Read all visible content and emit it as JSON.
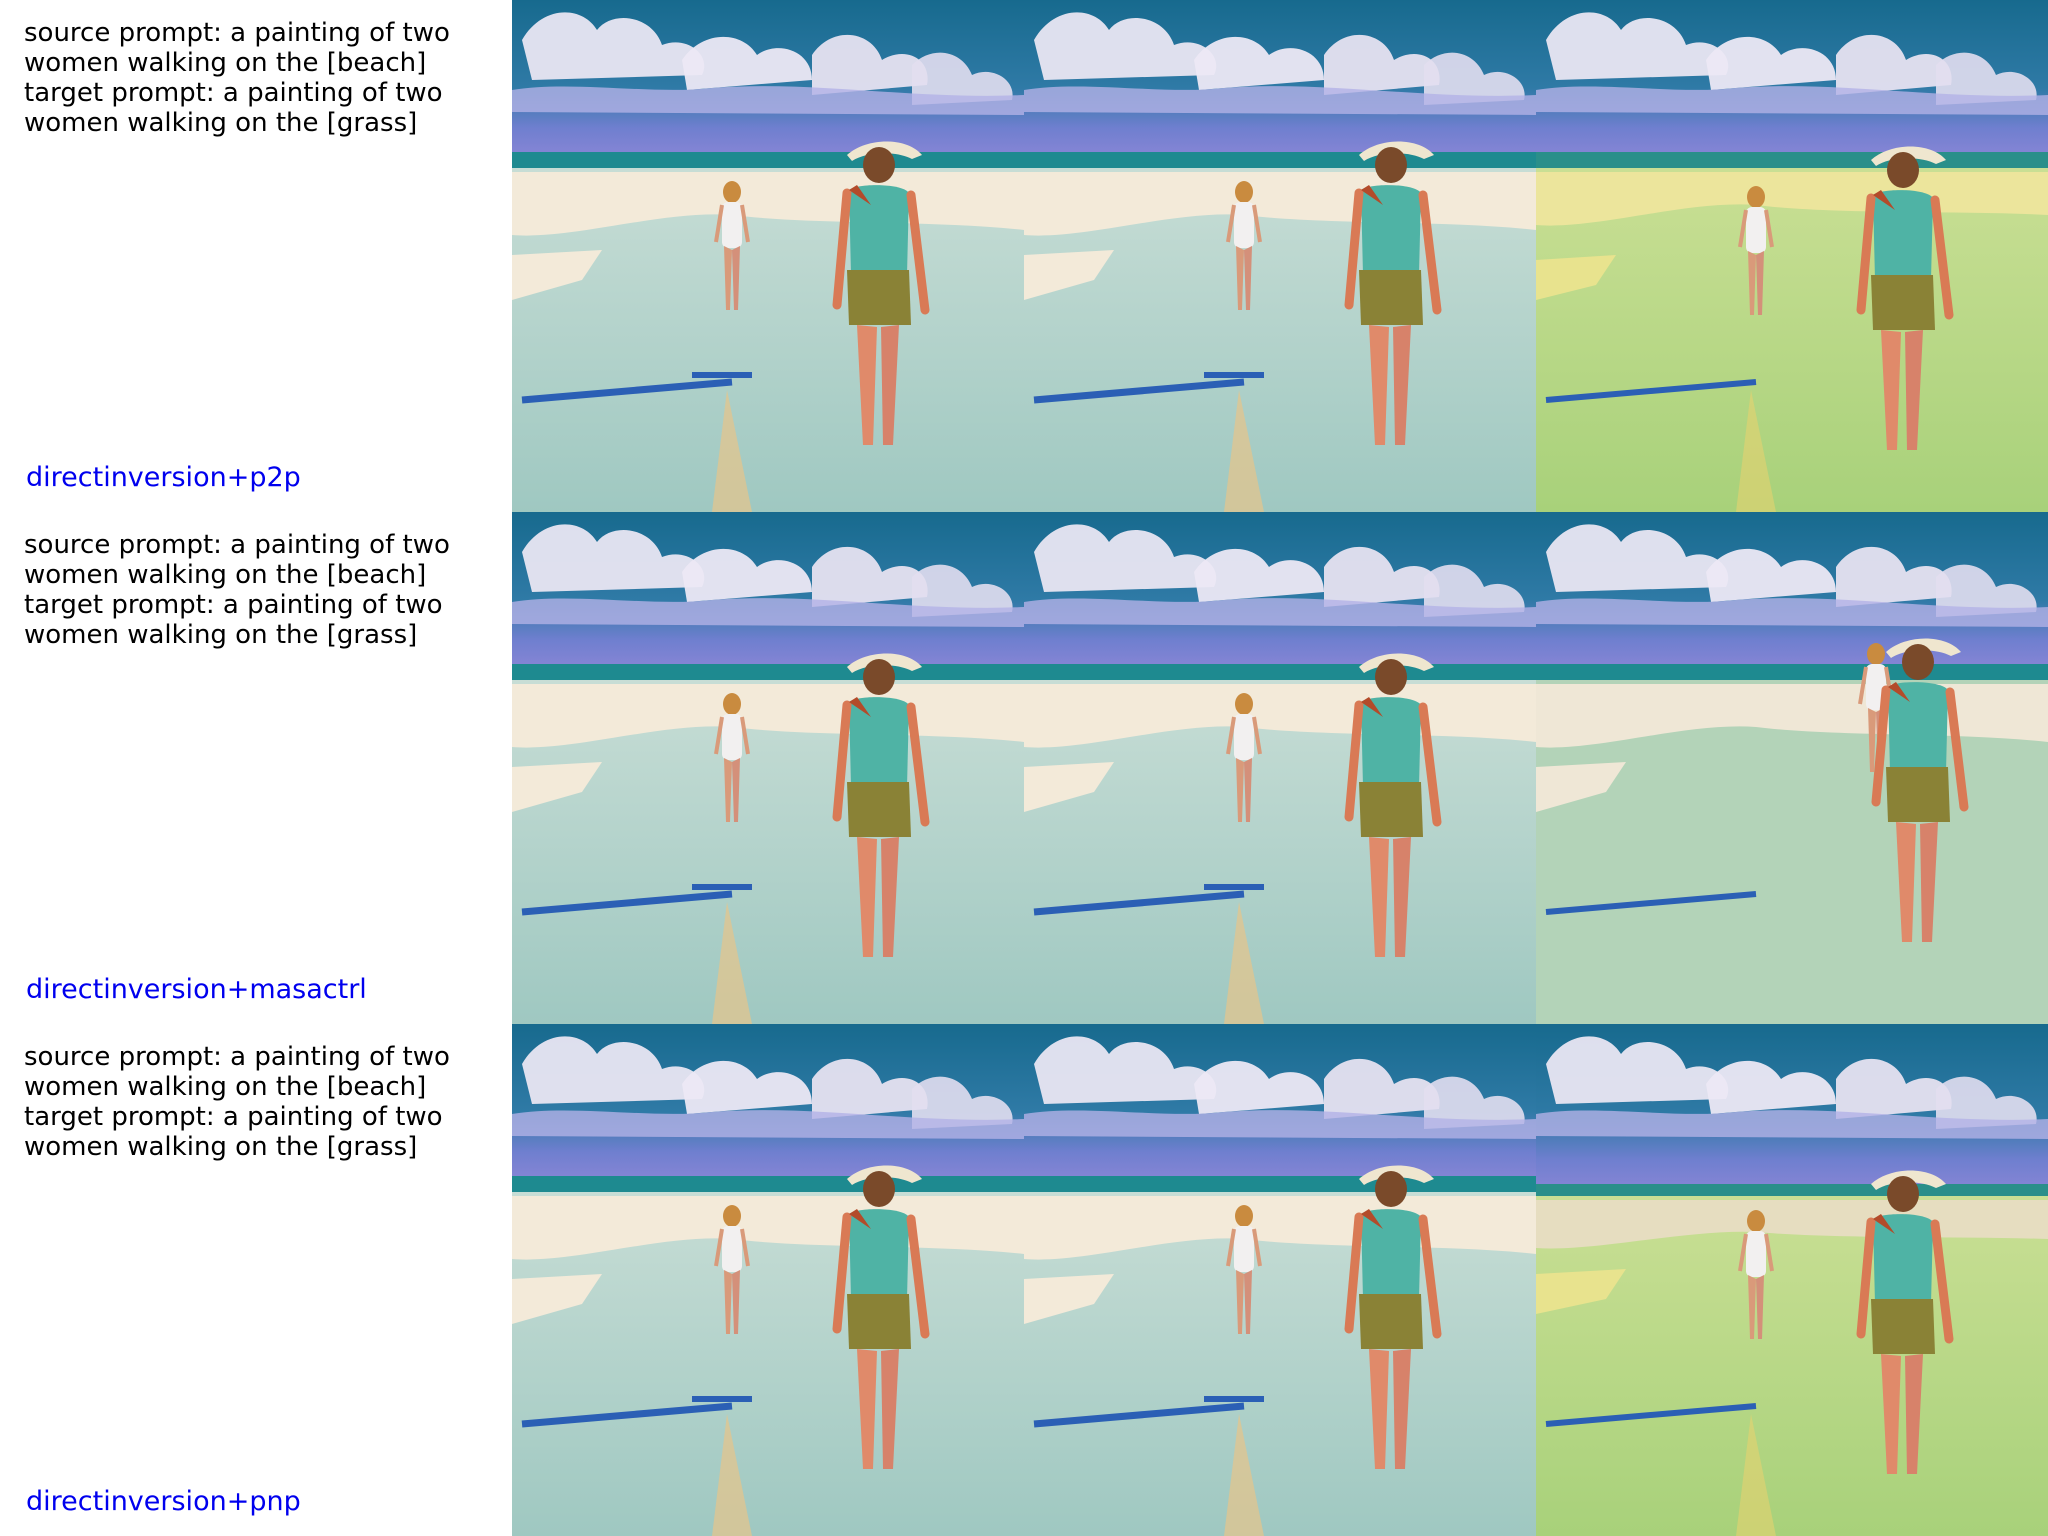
{
  "rows": [
    {
      "prompt_lines": [
        "source prompt: a painting of two",
        "women walking on the [beach]",
        "target prompt: a painting of two",
        "women walking on the [grass]"
      ],
      "method": "directinversion+p2p"
    },
    {
      "prompt_lines": [
        "source prompt: a painting of two",
        "women walking on the [beach]",
        "target prompt: a painting of two",
        "women walking on the [grass]"
      ],
      "method": "directinversion+masactrl"
    },
    {
      "prompt_lines": [
        "source prompt: a painting of two",
        "women walking on the [beach]",
        "target prompt: a painting of two",
        "women walking on the [grass]"
      ],
      "method": "directinversion+pnp"
    }
  ],
  "colors": {
    "method_label": "#0000ee",
    "sky_top": "#1e6f93",
    "sky_band": "#7e7fd0",
    "sea": "#1e8a90",
    "beach_sand": "#f2e8d8",
    "beach_ground": "#a9cfc7",
    "grass_ground": "#b9d88a",
    "grass_sand": "#e8e49a",
    "shadow": "#2b5fb5"
  },
  "image_icons": [
    "source-painting",
    "reconstruction-painting",
    "edited-painting"
  ]
}
